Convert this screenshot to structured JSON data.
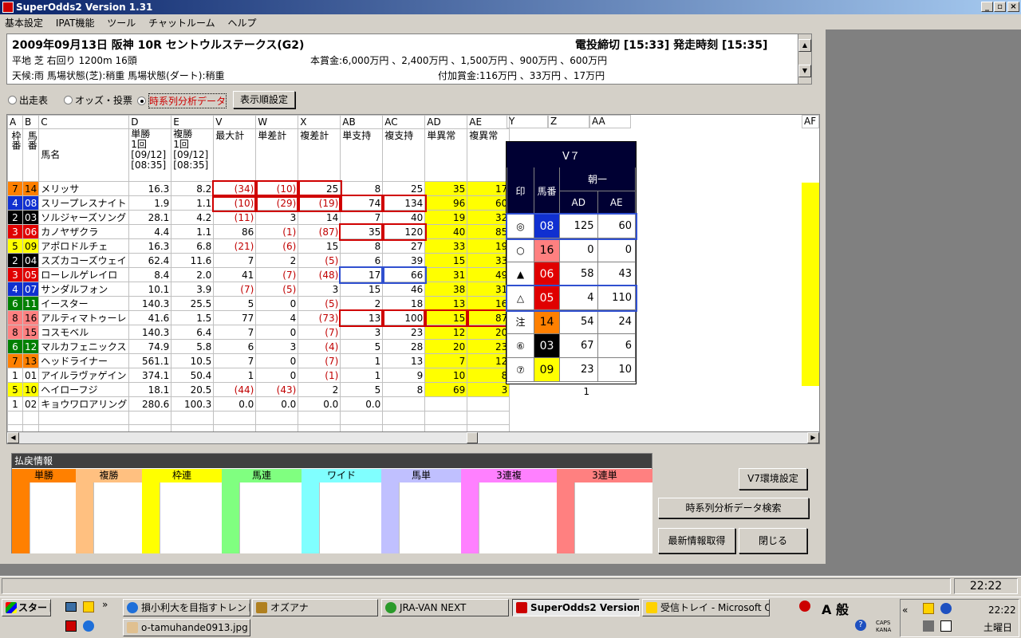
{
  "window": {
    "title": "SuperOdds2 Version 1.31"
  },
  "menu": [
    "基本設定",
    "IPAT機能",
    "ツール",
    "チャットルーム",
    "ヘルプ"
  ],
  "race": {
    "title": "2009年09月13日 阪神  10R セントウルステークス(G2)",
    "deadline": "電投締切 [15:33] 発走時刻 [15:35]",
    "course": "平地  芝     右回り  1200m 16頭",
    "prize": "本賞金:6,000万円 、2,400万円 、1,500万円 、900万円 、600万円",
    "weather": "天候:雨  馬場状態(芝):稍重  馬場状態(ダート):稍重",
    "extra_prize": "付加賞金:116万円 、33万円 、17万円"
  },
  "views": {
    "r1": "出走表",
    "r2": "オッズ・投票",
    "r3": "時系列分析データ",
    "order_btn": "表示順設定"
  },
  "grid": {
    "letters": [
      "A",
      "B",
      "C",
      "D",
      "E",
      "V",
      "W",
      "X",
      "AB",
      "AC",
      "AD",
      "AE",
      "Y",
      "Z",
      "AA",
      "AF"
    ],
    "headers": [
      "枠番",
      "馬番",
      "馬名",
      "単勝\n1回\n[09/12]\n[08:35]",
      "複勝\n1回\n[09/12]\n[08:35]",
      "最大計",
      "単差計",
      "複差計",
      "単支持",
      "複支持",
      "単異常",
      "複異常"
    ],
    "rows": [
      [
        "7",
        "14",
        "メリッサ",
        "16.3",
        "8.2",
        "(34)",
        "(10)",
        "25",
        "8",
        "25",
        "35",
        "17"
      ],
      [
        "4",
        "08",
        "スリープレスナイト",
        "1.9",
        "1.1",
        "(10)",
        "(29)",
        "(19)",
        "74",
        "134",
        "96",
        "60"
      ],
      [
        "2",
        "03",
        "ソルジャーズソング",
        "28.1",
        "4.2",
        "(11)",
        "3",
        "14",
        "7",
        "40",
        "19",
        "32"
      ],
      [
        "3",
        "06",
        "カノヤザクラ",
        "4.4",
        "1.1",
        "86",
        "(1)",
        "(87)",
        "35",
        "120",
        "40",
        "85"
      ],
      [
        "5",
        "09",
        "アポロドルチェ",
        "16.3",
        "6.8",
        "(21)",
        "(6)",
        "15",
        "8",
        "27",
        "33",
        "19"
      ],
      [
        "2",
        "04",
        "スズカコーズウェイ",
        "62.4",
        "11.6",
        "7",
        "2",
        "(5)",
        "6",
        "39",
        "15",
        "33"
      ],
      [
        "3",
        "05",
        "ローレルゲレイロ",
        "8.4",
        "2.0",
        "41",
        "(7)",
        "(48)",
        "17",
        "66",
        "31",
        "49"
      ],
      [
        "4",
        "07",
        "サンダルフォン",
        "10.1",
        "3.9",
        "(7)",
        "(5)",
        "3",
        "15",
        "46",
        "38",
        "31"
      ],
      [
        "6",
        "11",
        "イースター",
        "140.3",
        "25.5",
        "5",
        "0",
        "(5)",
        "2",
        "18",
        "13",
        "16"
      ],
      [
        "8",
        "16",
        "アルティマトゥーレ",
        "41.6",
        "1.5",
        "77",
        "4",
        "(73)",
        "13",
        "100",
        "15",
        "87"
      ],
      [
        "8",
        "15",
        "コスモベル",
        "140.3",
        "6.4",
        "7",
        "0",
        "(7)",
        "3",
        "23",
        "12",
        "20"
      ],
      [
        "6",
        "12",
        "マルカフェニックス",
        "74.9",
        "5.8",
        "6",
        "3",
        "(4)",
        "5",
        "28",
        "20",
        "23"
      ],
      [
        "7",
        "13",
        "ヘッドライナー",
        "561.1",
        "10.5",
        "7",
        "0",
        "(7)",
        "1",
        "13",
        "7",
        "12"
      ],
      [
        "1",
        "01",
        "アイルラヴァゲイン",
        "374.1",
        "50.4",
        "1",
        "0",
        "(1)",
        "1",
        "9",
        "10",
        "8"
      ],
      [
        "5",
        "10",
        "ヘイローフジ",
        "18.1",
        "20.5",
        "(44)",
        "(43)",
        "2",
        "5",
        "8",
        "69",
        "3"
      ],
      [
        "1",
        "02",
        "キョウワロアリング",
        "280.6",
        "100.3",
        "0.0",
        "0.0",
        "0.0",
        "0.0",
        "",
        "",
        ""
      ]
    ],
    "z_value": "1"
  },
  "v7": {
    "title": "V７",
    "group": "朝一",
    "col_mark": "印",
    "col_num": "馬番",
    "col_ad": "AD",
    "col_ae": "AE",
    "rows": [
      [
        "◎",
        "08",
        "125",
        "60"
      ],
      [
        "○",
        "16",
        "0",
        "0"
      ],
      [
        "▲",
        "06",
        "58",
        "43"
      ],
      [
        "△",
        "05",
        "4",
        "110"
      ],
      [
        "注",
        "14",
        "54",
        "24"
      ],
      [
        "⑥",
        "03",
        "67",
        "6"
      ],
      [
        "⑦",
        "09",
        "23",
        "10"
      ]
    ]
  },
  "payout": {
    "title": "払戻情報",
    "cols": [
      "単勝",
      "複勝",
      "枠連",
      "馬連",
      "ワイド",
      "馬単",
      "3連複",
      "3連単"
    ]
  },
  "buttons": {
    "v7_settings": "V7環境設定",
    "search": "時系列分析データ検索",
    "refresh": "最新情報取得",
    "close": "閉じる"
  },
  "status": {
    "time": "22:22"
  },
  "taskbar": {
    "start": "スタート",
    "tasks": [
      "損小利大を目指すトレンド...",
      "オズアナ",
      "JRA-VAN NEXT",
      "SuperOdds2 Version...",
      "受信トレイ - Microsoft O...",
      "o-tamuhande0913.jpg - ..."
    ],
    "clock": "22:22",
    "day": "土曜日",
    "ime": "A 般",
    "caps": "CAPS",
    "kana": "KANA"
  }
}
